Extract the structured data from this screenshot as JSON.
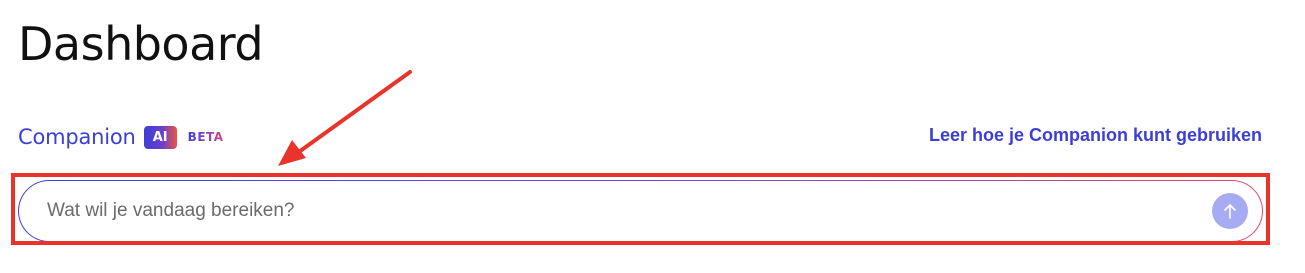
{
  "header": {
    "title": "Dashboard"
  },
  "companion": {
    "title": "Companion",
    "ai_badge": "AI",
    "beta_label": "BETA",
    "learn_link": "Leer hoe je Companion kunt gebruiken",
    "prompt": {
      "placeholder": "Wat wil je vandaag bereiken?",
      "value": ""
    },
    "send_icon": "arrow-up-icon"
  },
  "annotation": {
    "arrow_icon": "pointer-arrow-icon",
    "highlight_color": "#e8342b"
  },
  "colors": {
    "accent": "#3b3fd8",
    "send_button": "#a7abf3"
  }
}
